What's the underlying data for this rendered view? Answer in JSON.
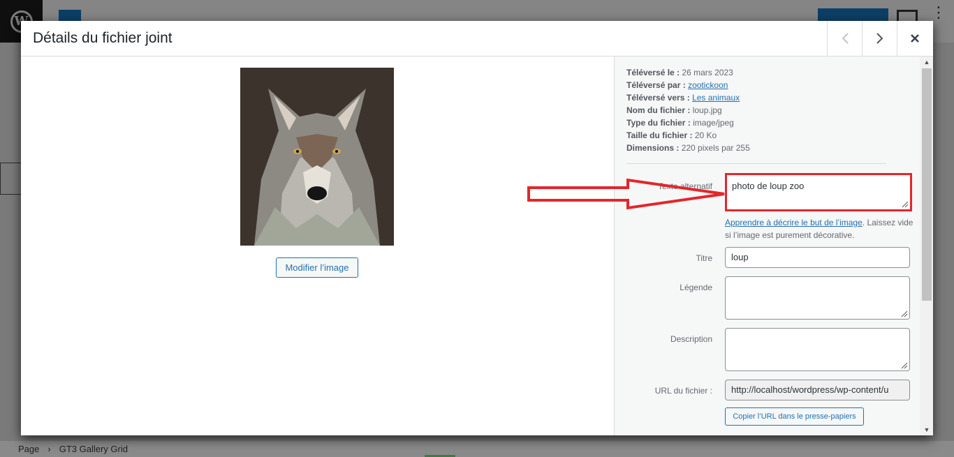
{
  "modal": {
    "title": "Détails du fichier joint",
    "prev_icon": "chevron-left-icon",
    "next_icon": "chevron-right-icon",
    "close_icon": "close-icon",
    "edit_image_label": "Modifier l’image"
  },
  "meta": {
    "uploaded_on_label": "Téléversé le :",
    "uploaded_on": "26 mars 2023",
    "uploaded_by_label": "Téléversé par :",
    "uploaded_by": "zootickoon",
    "uploaded_to_label": "Téléversé vers :",
    "uploaded_to": "Les animaux",
    "filename_label": "Nom du fichier :",
    "filename": "loup.jpg",
    "filetype_label": "Type du fichier :",
    "filetype": "image/jpeg",
    "filesize_label": "Taille du fichier :",
    "filesize": "20 Ko",
    "dimensions_label": "Dimensions :",
    "dimensions": "220 pixels par 255"
  },
  "fields": {
    "alt_label": "Texte alternatif",
    "alt_value": "photo de loup zoo",
    "help_link": "Apprendre à décrire le but de l’image",
    "help_text": ". Laissez vide si l’image est purement décorative.",
    "title_label": "Titre",
    "title_value": "loup",
    "caption_label": "Légende",
    "caption_value": "",
    "description_label": "Description",
    "description_value": "",
    "url_label": "URL du fichier :",
    "url_value": "http://localhost/wordpress/wp-content/u",
    "copy_url_label": "Copier l’URL dans le presse-papiers"
  },
  "footer": {
    "breadcrumb_1": "Page",
    "breadcrumb_2": "GT3 Gallery Grid"
  },
  "colors": {
    "accent": "#2271b1",
    "highlight": "#e4262b"
  }
}
